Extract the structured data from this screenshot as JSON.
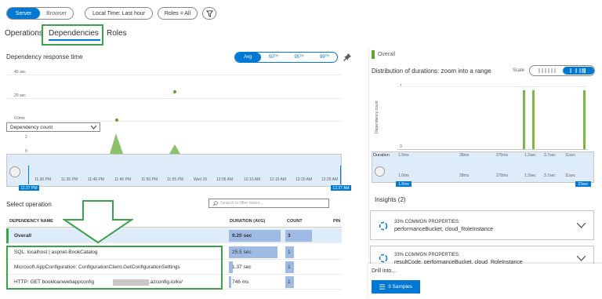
{
  "top_bar": {
    "server": "Server",
    "browser": "Browser",
    "local_time": "Local Time: Last hour",
    "roles": "Roles = All"
  },
  "tabs": [
    "Operations",
    "Dependencies",
    "Roles"
  ],
  "left_panel": {
    "title": "Dependency response time",
    "percentiles": [
      "Avg",
      "50ᵀᴴ",
      "95ᵀᴴ",
      "99ᵀᴴ"
    ],
    "y_labels": [
      "40 sec",
      "20 sec",
      "0.0ms"
    ],
    "count_y_labels": [
      "2",
      "0"
    ],
    "dropdown": "Dependency count",
    "x_ticks": [
      "11:30 PM",
      "11:35 PM",
      "11:40 PM",
      "11:45 PM",
      "11:50 PM",
      "11:55 PM",
      "Wed 26",
      "12:05 AM",
      "12:10 AM",
      "12:15 AM",
      "12:20 AM",
      "12:25 AM"
    ],
    "brush_start": "11:27 PM",
    "brush_end": "12:27 AM"
  },
  "operations": {
    "title": "Select operation",
    "search_placeholder": "Search to filter items...",
    "columns": {
      "name": "DEPENDENCY NAME",
      "duration": "DURATION (AVG)",
      "count": "COUNT",
      "pin": "PIN"
    },
    "rows": [
      {
        "name": "Overall",
        "duration": "9.20 sec",
        "count": "3",
        "dur_frac": 1.0,
        "cnt_frac": 1.0
      },
      {
        "name": "SQL: localhost | aspnet-BookCatalog",
        "duration": "25.5 sec",
        "count": "1",
        "dur_frac": 0.95,
        "cnt_frac": 0.33
      },
      {
        "name": "Microsoft.AppConfiguration: ConfigurationClient.GetConfigurationSettings",
        "duration": "1.37 sec",
        "count": "1",
        "dur_frac": 0.08,
        "cnt_frac": 0.33
      },
      {
        "name": "HTTP: GET bookloanwebappconfig",
        "name_suffix": ".azconfig.io/kv/",
        "duration": "746 ms",
        "count": "1",
        "dur_frac": 0.04,
        "cnt_frac": 0.33
      }
    ]
  },
  "right_panel": {
    "overall_label": "Overall",
    "dist_title": "Distribution of durations: zoom into a range",
    "scale_label": "Scale",
    "y_axis": "Dependency count",
    "y_ticks": [
      "1",
      "0"
    ],
    "duration_label": "Duration",
    "x_ticks": [
      "1.0ms",
      "28ms",
      "270ms",
      "1.2sec",
      "3.7sec",
      "11sec"
    ],
    "range_start": "1.0ms",
    "range_end": "23sec",
    "insights_title": "Insights (2)",
    "insights": [
      {
        "line1": "33% COMMON PROPERTIES:",
        "line2": "performanceBucket, cloud_RoleInstance"
      },
      {
        "line1": "33% COMMON PROPERTIES:",
        "line2": "resultCode, performanceBucket, cloud_RoleInstance"
      }
    ],
    "drill_into": "Drill into...",
    "samples_button": "3 Samples"
  },
  "colors": {
    "accent": "#0078d4",
    "bar_green": "#7ab648",
    "highlight_green": "#3ca14b",
    "bar_blue": "#9fbbe4"
  }
}
